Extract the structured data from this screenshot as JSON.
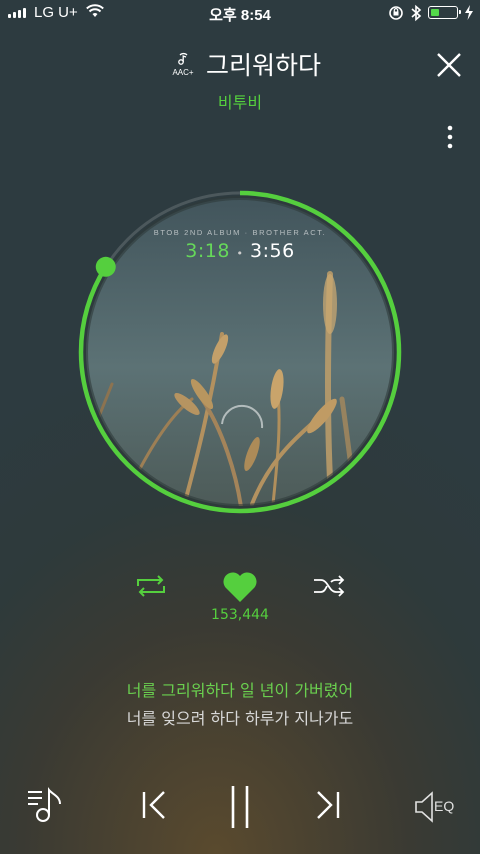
{
  "status_bar": {
    "carrier": "LG U+",
    "time": "오후 8:54",
    "battery_level": 0.35
  },
  "header": {
    "quality_badge": "AAC+",
    "song_title": "그리워하다",
    "artist": "비투비"
  },
  "album": {
    "caption": "BTOB 2ND ALBUM · BROTHER ACT.",
    "current_time": "3:18",
    "separator": "•",
    "total_time": "3:56",
    "progress": 0.84
  },
  "actions": {
    "like_count": "153,444"
  },
  "lyrics": {
    "current_line": "너를 그리워하다 일 년이 가버렸어",
    "next_line": "너를 잊으려 하다 하루가 지나가도"
  },
  "player_controls": {
    "eq_label": "EQ"
  },
  "colors": {
    "accent": "#55cf3e",
    "text": "#ffffff"
  },
  "icons": [
    "music-quality-icon",
    "close-icon",
    "more-vertical-icon",
    "repeat-icon",
    "heart-icon",
    "shuffle-icon",
    "playlist-icon",
    "previous-icon",
    "pause-icon",
    "next-icon",
    "eq-speaker-icon"
  ]
}
